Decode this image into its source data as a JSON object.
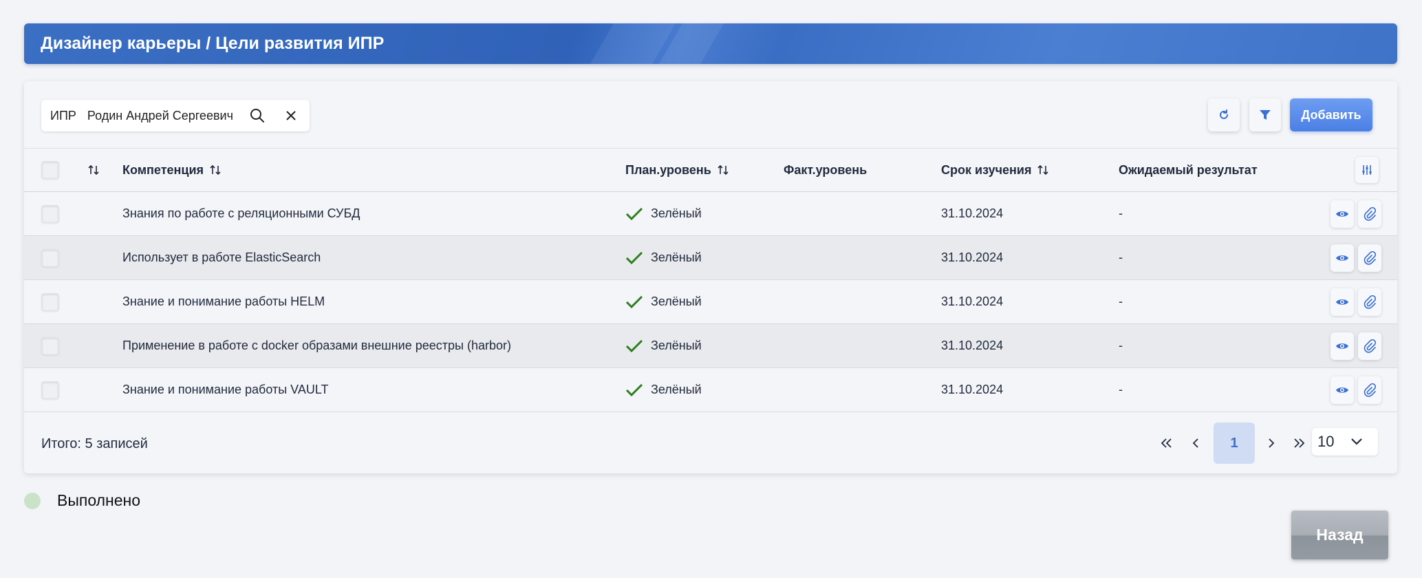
{
  "page": {
    "title": "Дизайнер карьеры / Цели развития ИПР"
  },
  "search": {
    "prefix": "ИПР",
    "value": "Родин Андрей Сергеевич"
  },
  "toolbar": {
    "add_label": "Добавить"
  },
  "table": {
    "columns": {
      "competency": "Компетенция",
      "plan_level": "План.уровень",
      "fact_level": "Факт.уровень",
      "study_term": "Срок изучения",
      "expected_result": "Ожидаемый результат"
    },
    "rows": [
      {
        "competency": "Знания по работе с реляционными СУБД",
        "plan_level": "Зелёный",
        "fact_level": "",
        "study_term": "31.10.2024",
        "expected_result": "-"
      },
      {
        "competency": "Использует в работе ElasticSearch",
        "plan_level": "Зелёный",
        "fact_level": "",
        "study_term": "31.10.2024",
        "expected_result": "-"
      },
      {
        "competency": "Знание и понимание работы HELM",
        "plan_level": "Зелёный",
        "fact_level": "",
        "study_term": "31.10.2024",
        "expected_result": "-"
      },
      {
        "competency": "Применение в работе с docker образами внешние реестры (harbor)",
        "plan_level": "Зелёный",
        "fact_level": "",
        "study_term": "31.10.2024",
        "expected_result": "-"
      },
      {
        "competency": "Знание и понимание работы VAULT",
        "plan_level": "Зелёный",
        "fact_level": "",
        "study_term": "31.10.2024",
        "expected_result": "-"
      }
    ]
  },
  "footer": {
    "total": "Итого: 5 записей",
    "current_page": "1",
    "per_page": "10"
  },
  "legend": {
    "done_label": "Выполнено",
    "done_color": "#c9e2c8"
  },
  "back_label": "Назад",
  "colors": {
    "accent": "#4a7fe4",
    "check_green": "#2e7d1e"
  }
}
